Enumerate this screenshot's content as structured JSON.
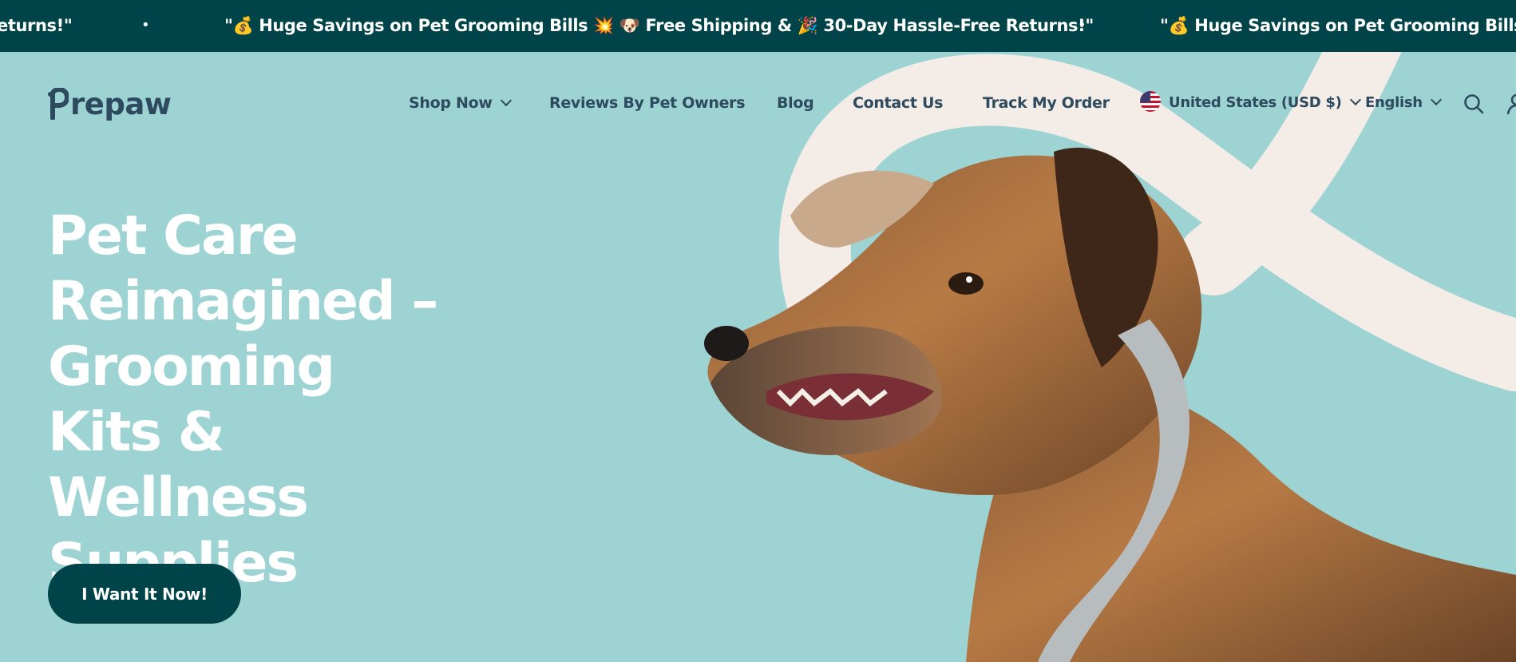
{
  "announcement": {
    "tail_text": "eturns!\"",
    "message": "\"💰 Huge Savings on Pet Grooming Bills 💥 🐶 Free Shipping & 🎉 30-Day Hassle-Free Returns!\"",
    "repeat_text": "\"💰 Huge Savings on Pet Grooming Bills 💥",
    "separator": "•"
  },
  "header": {
    "logo_text": "repaw",
    "nav": [
      {
        "label": "Shop Now",
        "has_dropdown": true
      },
      {
        "label": "Reviews By Pet Owners"
      },
      {
        "label": "Blog"
      },
      {
        "label": "Contact Us"
      },
      {
        "label": "Track My Order"
      }
    ],
    "country_selector": "United States (USD $)",
    "language_selector": "English",
    "icons": [
      "search-icon",
      "account-icon"
    ]
  },
  "hero": {
    "title": "Pet Care Reimagined – Grooming Kits & Wellness Supplies",
    "cta_label": "I Want It Now!"
  },
  "colors": {
    "announcement_bg": "#004449",
    "hero_bg": "#9dd3d3",
    "nav_text": "#2d4a5e",
    "cta_bg": "#004449",
    "swirl": "#f3ece7"
  }
}
